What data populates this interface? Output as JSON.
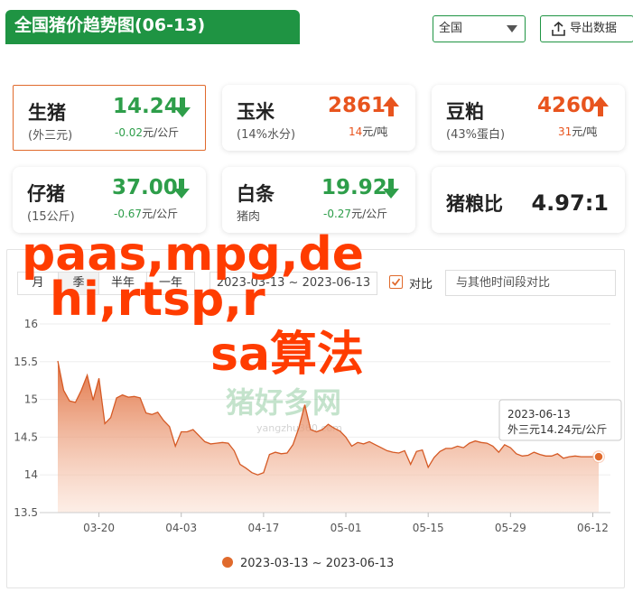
{
  "header": {
    "title": "全国猪价趋势图(06-13)",
    "region": "全国",
    "export_label": "导出数据"
  },
  "cards": [
    {
      "name": "生猪",
      "sub": "(外三元)",
      "price": "14.24",
      "trend": "down",
      "change": "-0.02",
      "unit": "元/公斤"
    },
    {
      "name": "玉米",
      "sub": "(14%水分)",
      "price": "2861",
      "trend": "up",
      "change": "14",
      "unit": "元/吨"
    },
    {
      "name": "豆粕",
      "sub": "(43%蛋白)",
      "price": "4260",
      "trend": "up",
      "change": "31",
      "unit": "元/吨"
    },
    {
      "name": "仔猪",
      "sub": "(15公斤)",
      "price": "37.00",
      "trend": "down",
      "change": "-0.67",
      "unit": "元/公斤"
    },
    {
      "name": "白条",
      "sub": "猪肉",
      "price": "19.92",
      "trend": "down",
      "change": "-0.27",
      "unit": "元/公斤"
    },
    {
      "name": "猪粮比",
      "ratio": "4.97:1"
    }
  ],
  "toolbar": {
    "periods": [
      "月",
      "季",
      "半年",
      "一年"
    ],
    "active_period": "季",
    "date_range": "2023-03-13 ~ 2023-06-13",
    "compare_label": "对比",
    "compare_checked": true,
    "compare_placeholder": "与其他时间段对比"
  },
  "overlay": {
    "line1": "paas,mpg,de",
    "line2": "hi,rtsp,r",
    "line3": "sa算法"
  },
  "watermark": {
    "logo": "猪好多网",
    "url": "yangzhu360.com"
  },
  "colors": {
    "brand_green": "#1f9443",
    "down_green": "#2e9e4a",
    "up_orange": "#e8541e",
    "series": "#e06a2c"
  },
  "chart_data": {
    "type": "area",
    "ylim": [
      13.5,
      16
    ],
    "yticks": [
      "16",
      "15.5",
      "15",
      "14.5",
      "14",
      "13.5"
    ],
    "xticks": [
      "03-20",
      "04-03",
      "04-17",
      "05-01",
      "05-15",
      "05-29",
      "06-12"
    ],
    "x_start": "2023-03-13",
    "legend": "2023-03-13 ~ 2023-06-13",
    "tooltip": {
      "date": "2023-06-13",
      "text": "外三元14.24元/公斤"
    },
    "values": [
      15.51,
      15.12,
      14.98,
      14.96,
      15.12,
      15.32,
      14.99,
      15.28,
      14.68,
      14.76,
      15.02,
      15.06,
      15.03,
      15.04,
      15.02,
      14.82,
      14.8,
      14.83,
      14.72,
      14.64,
      14.38,
      14.57,
      14.57,
      14.6,
      14.52,
      14.44,
      14.41,
      14.42,
      14.43,
      14.42,
      14.32,
      14.14,
      14.09,
      14.03,
      14.0,
      14.03,
      14.27,
      14.3,
      14.28,
      14.29,
      14.4,
      14.62,
      14.93,
      14.6,
      14.57,
      14.6,
      14.67,
      14.62,
      14.58,
      14.5,
      14.38,
      14.43,
      14.41,
      14.44,
      14.4,
      14.36,
      14.32,
      14.3,
      14.29,
      14.32,
      14.14,
      14.31,
      14.33,
      14.1,
      14.23,
      14.31,
      14.35,
      14.35,
      14.38,
      14.36,
      14.42,
      14.45,
      14.43,
      14.42,
      14.38,
      14.3,
      14.4,
      14.36,
      14.28,
      14.25,
      14.26,
      14.3,
      14.27,
      14.25,
      14.25,
      14.28,
      14.22,
      14.24,
      14.25,
      14.24,
      14.24,
      14.24,
      14.24
    ]
  }
}
